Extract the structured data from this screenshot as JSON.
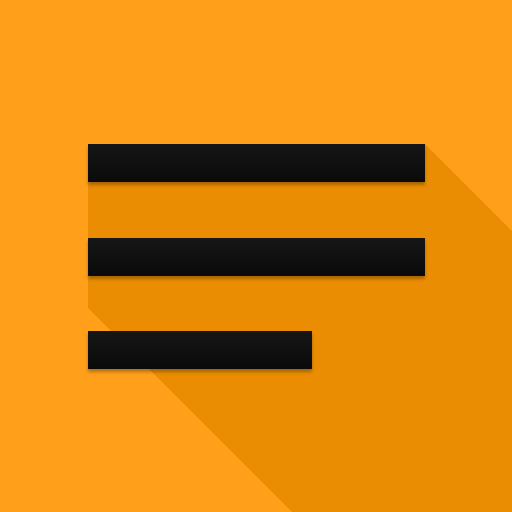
{
  "icon": {
    "name": "menu-lines-icon",
    "colors": {
      "background": "#FF9F1A",
      "long_shadow": "#E68900",
      "bars": "#111111"
    }
  }
}
